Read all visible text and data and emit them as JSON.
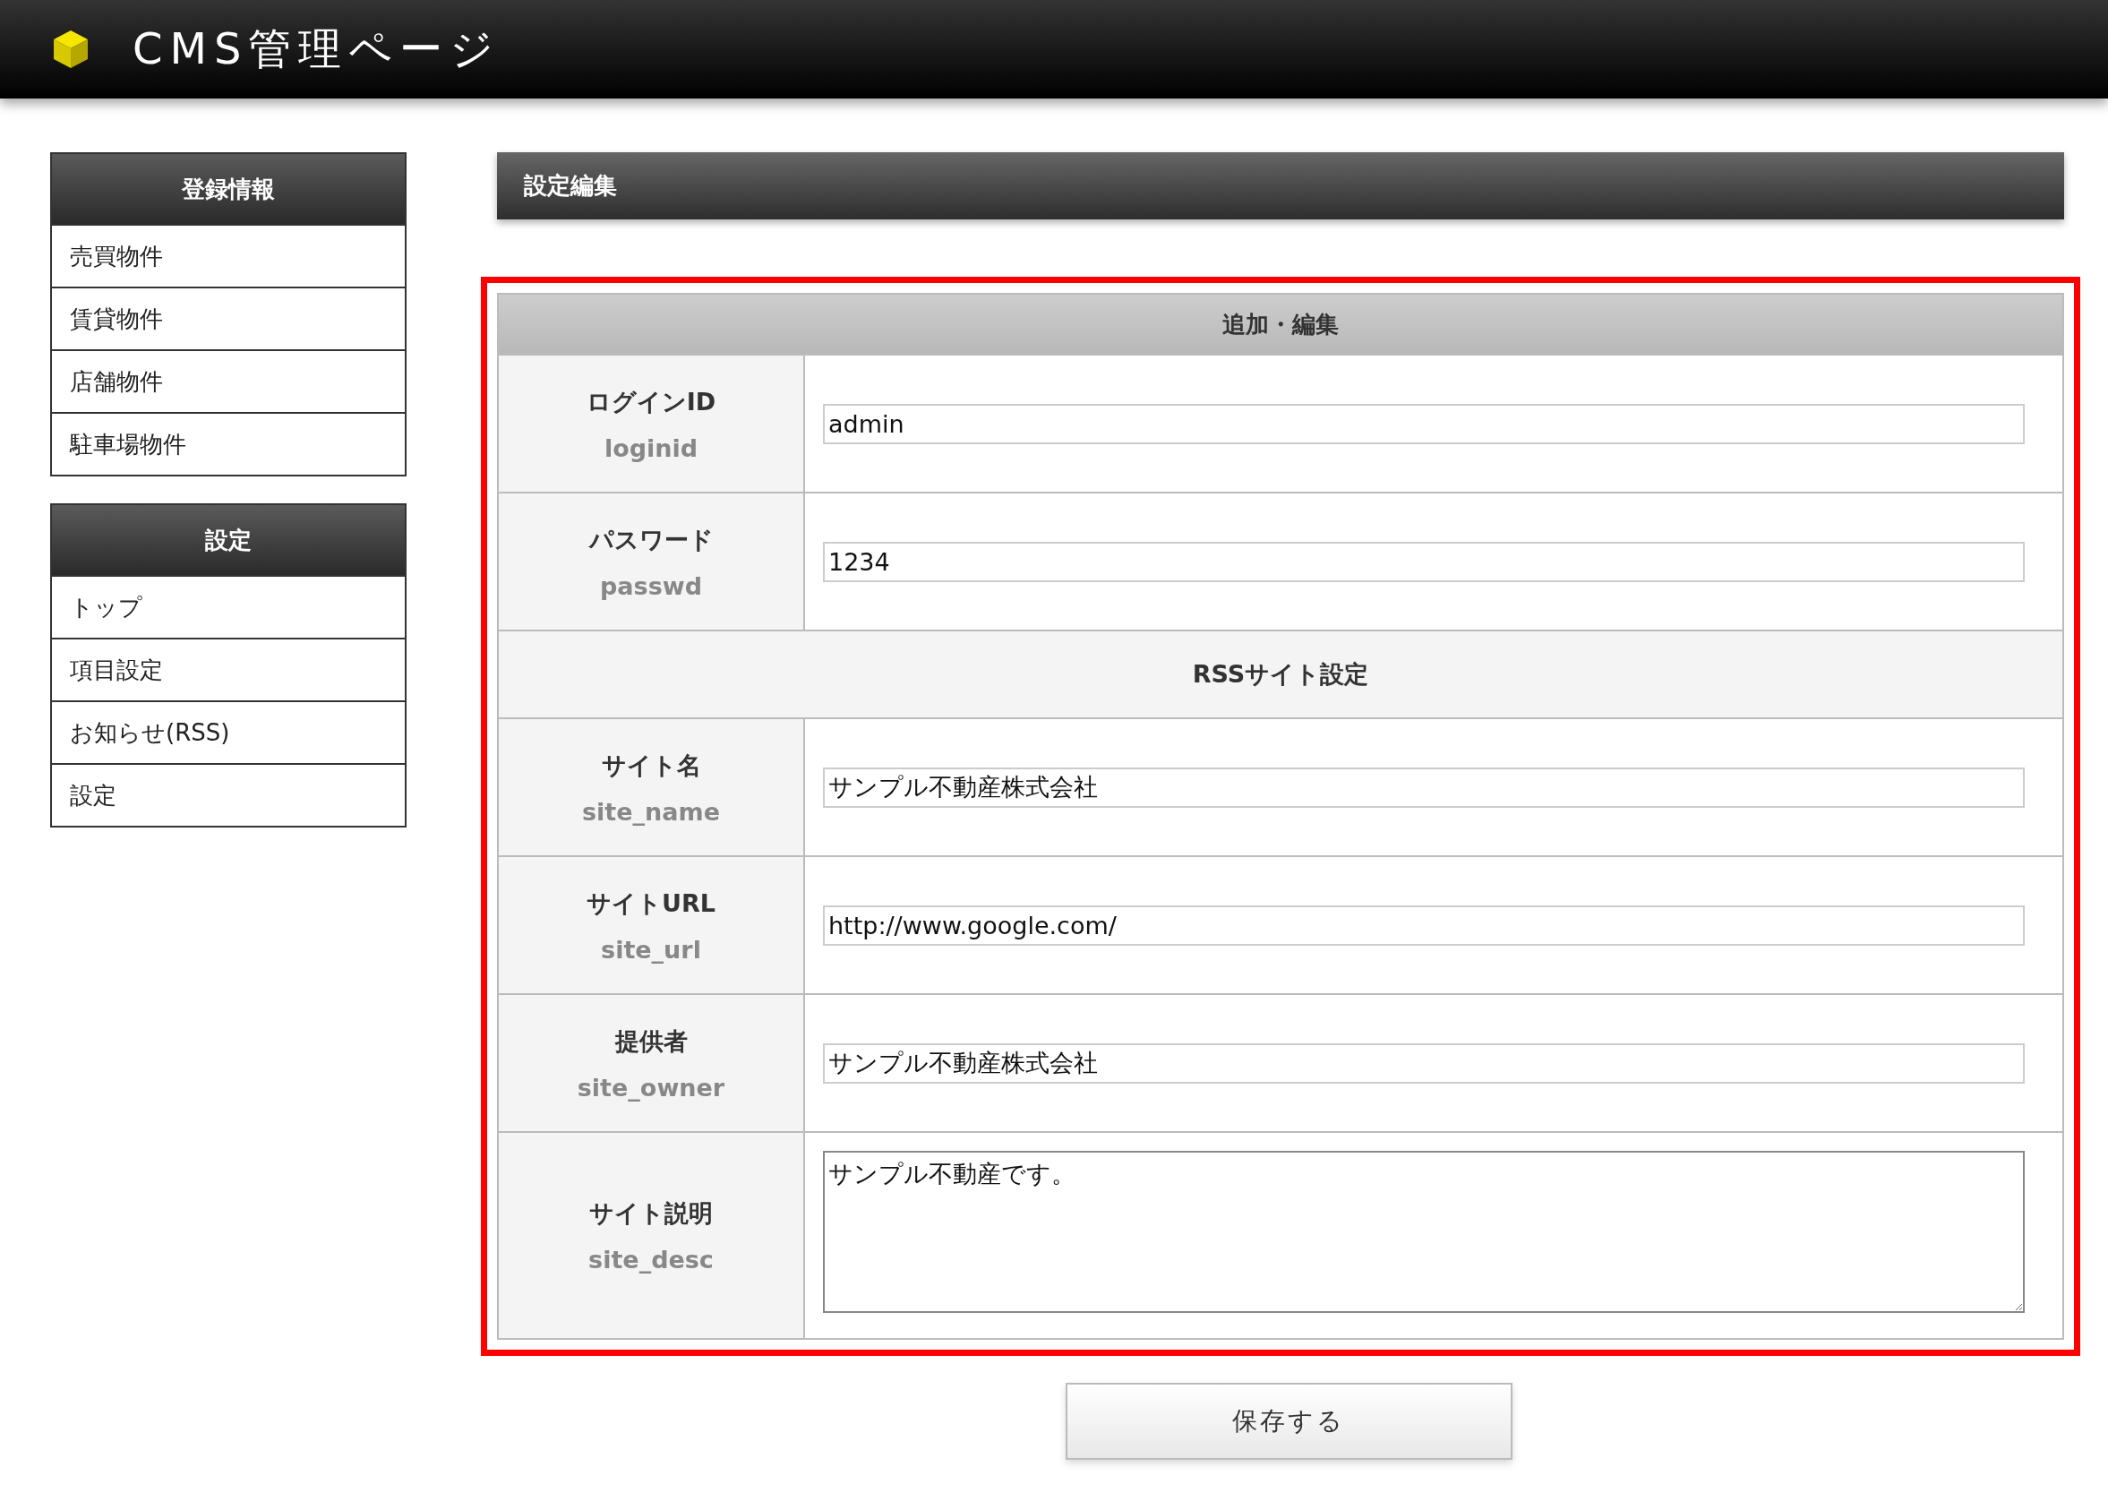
{
  "header": {
    "title": "CMS管理ページ"
  },
  "sidebar": {
    "groups": [
      {
        "title": "登録情報",
        "items": [
          {
            "label": "売買物件"
          },
          {
            "label": "賃貸物件"
          },
          {
            "label": "店舗物件"
          },
          {
            "label": "駐車場物件"
          }
        ]
      },
      {
        "title": "設定",
        "items": [
          {
            "label": "トップ"
          },
          {
            "label": "項目設定"
          },
          {
            "label": "お知らせ(RSS)"
          },
          {
            "label": "設定"
          }
        ]
      }
    ]
  },
  "panel": {
    "title": "設定編集"
  },
  "form": {
    "title": "追加・編集",
    "rows": [
      {
        "kind": "field",
        "label": "ログインID",
        "key": "loginid",
        "value": "admin"
      },
      {
        "kind": "field",
        "label": "パスワード",
        "key": "passwd",
        "value": "1234"
      },
      {
        "kind": "section",
        "label": "RSSサイト設定"
      },
      {
        "kind": "field",
        "label": "サイト名",
        "key": "site_name",
        "value": "サンプル不動産株式会社"
      },
      {
        "kind": "field",
        "label": "サイトURL",
        "key": "site_url",
        "value": "http://www.google.com/"
      },
      {
        "kind": "field",
        "label": "提供者",
        "key": "site_owner",
        "value": "サンプル不動産株式会社"
      },
      {
        "kind": "textarea",
        "label": "サイト説明",
        "key": "site_desc",
        "value": "サンプル不動産です。"
      }
    ]
  },
  "save_button": "保存する"
}
